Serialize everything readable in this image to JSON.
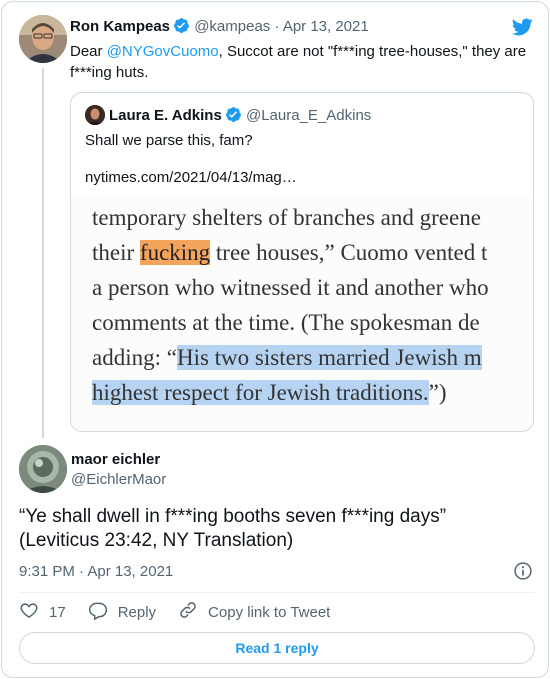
{
  "tweet1": {
    "name": "Ron Kampeas",
    "handle": "@kampeas",
    "separator": "·",
    "date": "Apr 13, 2021",
    "text_prefix": "Dear ",
    "mention": "@NYGovCuomo",
    "text_suffix": ",  Succot are not \"f***ing tree-houses,\" they are f***ing huts."
  },
  "quote": {
    "name": "Laura E. Adkins",
    "handle": "@Laura_E_Adkins",
    "text": "Shall we parse this, fam?",
    "link": "nytimes.com/2021/04/13/mag…",
    "image_lines": [
      {
        "before": "temporary shelters of branches and greene",
        "hl": "",
        "after": ""
      },
      {
        "before": "their ",
        "hl": "fucking",
        "after": " tree houses,” Cuomo vented t"
      },
      {
        "before": "a person who witnessed it and another who",
        "hl": "",
        "after": ""
      },
      {
        "before": "comments at the time. (The spokesman de",
        "hl": "",
        "after": ""
      },
      {
        "before": "adding: “",
        "hl": "His two sisters married Jewish m",
        "after": ""
      },
      {
        "before": "",
        "hl": "highest respect for Jewish traditions.",
        "after": "”)"
      }
    ]
  },
  "tweet2": {
    "name": "maor eichler",
    "handle": "@EichlerMaor",
    "text_line1": "“Ye shall dwell in f***ing booths seven f***ing days”",
    "text_line2": "(Leviticus 23:42, NY Translation)",
    "time": "9:31 PM · Apr 13, 2021"
  },
  "actions": {
    "like_count": "17",
    "reply_label": "Reply",
    "copy_label": "Copy link to Tweet"
  },
  "read_reply_label": "Read 1 reply",
  "colors": {
    "accent": "#1d9bf0",
    "muted": "#536471",
    "highlight_orange": "#f5a45c",
    "highlight_blue": "#b7d3f2"
  }
}
